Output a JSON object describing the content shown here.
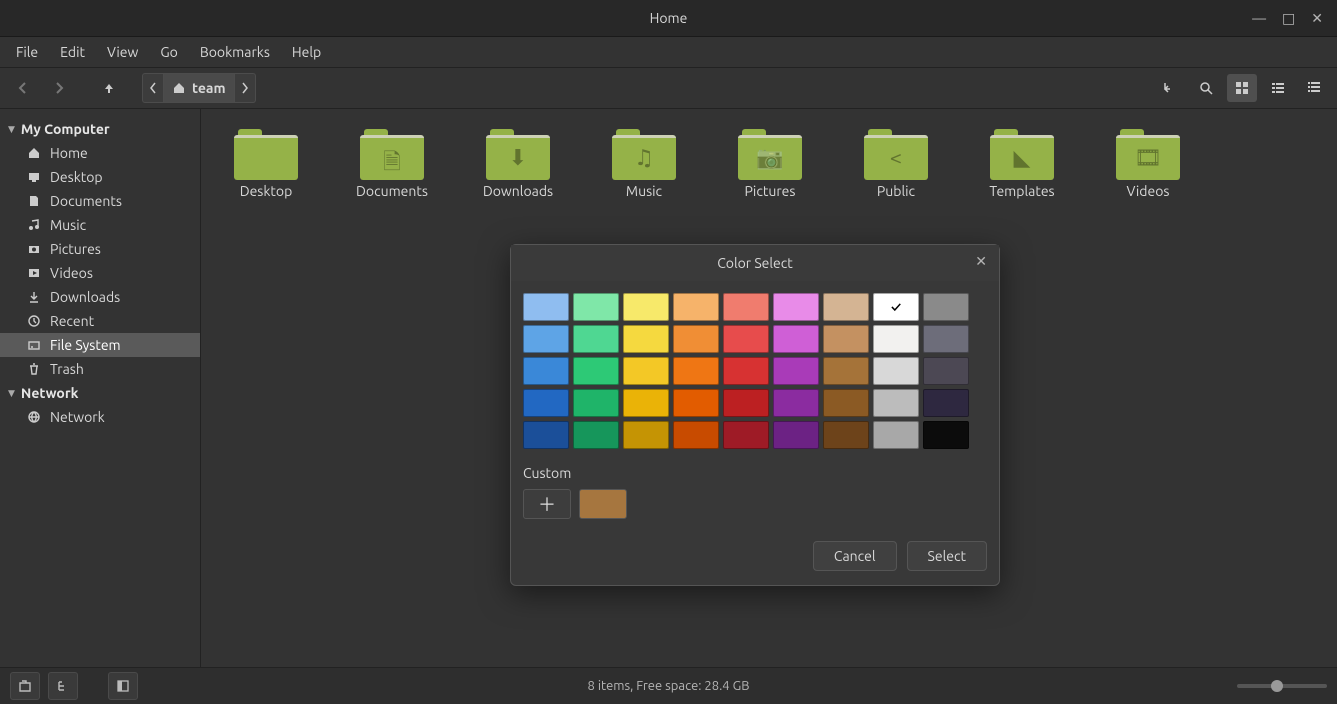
{
  "window": {
    "title": "Home"
  },
  "menubar": [
    "File",
    "Edit",
    "View",
    "Go",
    "Bookmarks",
    "Help"
  ],
  "path": {
    "crumb": "team"
  },
  "sidebar": {
    "header1": "My Computer",
    "items": [
      {
        "label": "Home",
        "icon": "home"
      },
      {
        "label": "Desktop",
        "icon": "desktop"
      },
      {
        "label": "Documents",
        "icon": "documents"
      },
      {
        "label": "Music",
        "icon": "music"
      },
      {
        "label": "Pictures",
        "icon": "pictures"
      },
      {
        "label": "Videos",
        "icon": "videos"
      },
      {
        "label": "Downloads",
        "icon": "downloads"
      },
      {
        "label": "Recent",
        "icon": "recent"
      },
      {
        "label": "File System",
        "icon": "filesystem"
      },
      {
        "label": "Trash",
        "icon": "trash"
      }
    ],
    "header2": "Network",
    "netitems": [
      {
        "label": "Network",
        "icon": "network"
      }
    ],
    "selected_index": 8
  },
  "files": [
    {
      "label": "Desktop",
      "glyph": ""
    },
    {
      "label": "Documents",
      "glyph": "🗎"
    },
    {
      "label": "Downloads",
      "glyph": "⬇"
    },
    {
      "label": "Music",
      "glyph": "♫"
    },
    {
      "label": "Pictures",
      "glyph": "📷"
    },
    {
      "label": "Public",
      "glyph": "<"
    },
    {
      "label": "Templates",
      "glyph": "◣"
    },
    {
      "label": "Videos",
      "glyph": "🎞"
    }
  ],
  "status": {
    "text": "8 items, Free space: 28.4 GB"
  },
  "dialog": {
    "title": "Color Select",
    "custom_label": "Custom",
    "cancel": "Cancel",
    "select": "Select",
    "custom_color": "#a6763f",
    "selected_index": 7,
    "colors": [
      "#8fbdf0",
      "#7fe7a8",
      "#f7e96a",
      "#f6b36a",
      "#f07c6e",
      "#e88be8",
      "#d4b493",
      "#ffffff",
      "#8a8a8a",
      "#5ea4e6",
      "#4fd792",
      "#f5d93f",
      "#f08e35",
      "#e74c4c",
      "#cf5fd6",
      "#c49161",
      "#f2f1ef",
      "#6d6d7a",
      "#3a88d8",
      "#2dc976",
      "#f3c826",
      "#ef7614",
      "#d73232",
      "#a93bb8",
      "#a57339",
      "#d8d8d8",
      "#4c4854",
      "#2268c2",
      "#1fb469",
      "#eab307",
      "#e25c00",
      "#bc2022",
      "#8b2ca0",
      "#8b5a24",
      "#bcbcbc",
      "#2e2840",
      "#1b4f99",
      "#16965b",
      "#c59404",
      "#c84b00",
      "#9e1b26",
      "#6c2284",
      "#6d431a",
      "#a8a8a8",
      "#0c0c0c"
    ]
  }
}
